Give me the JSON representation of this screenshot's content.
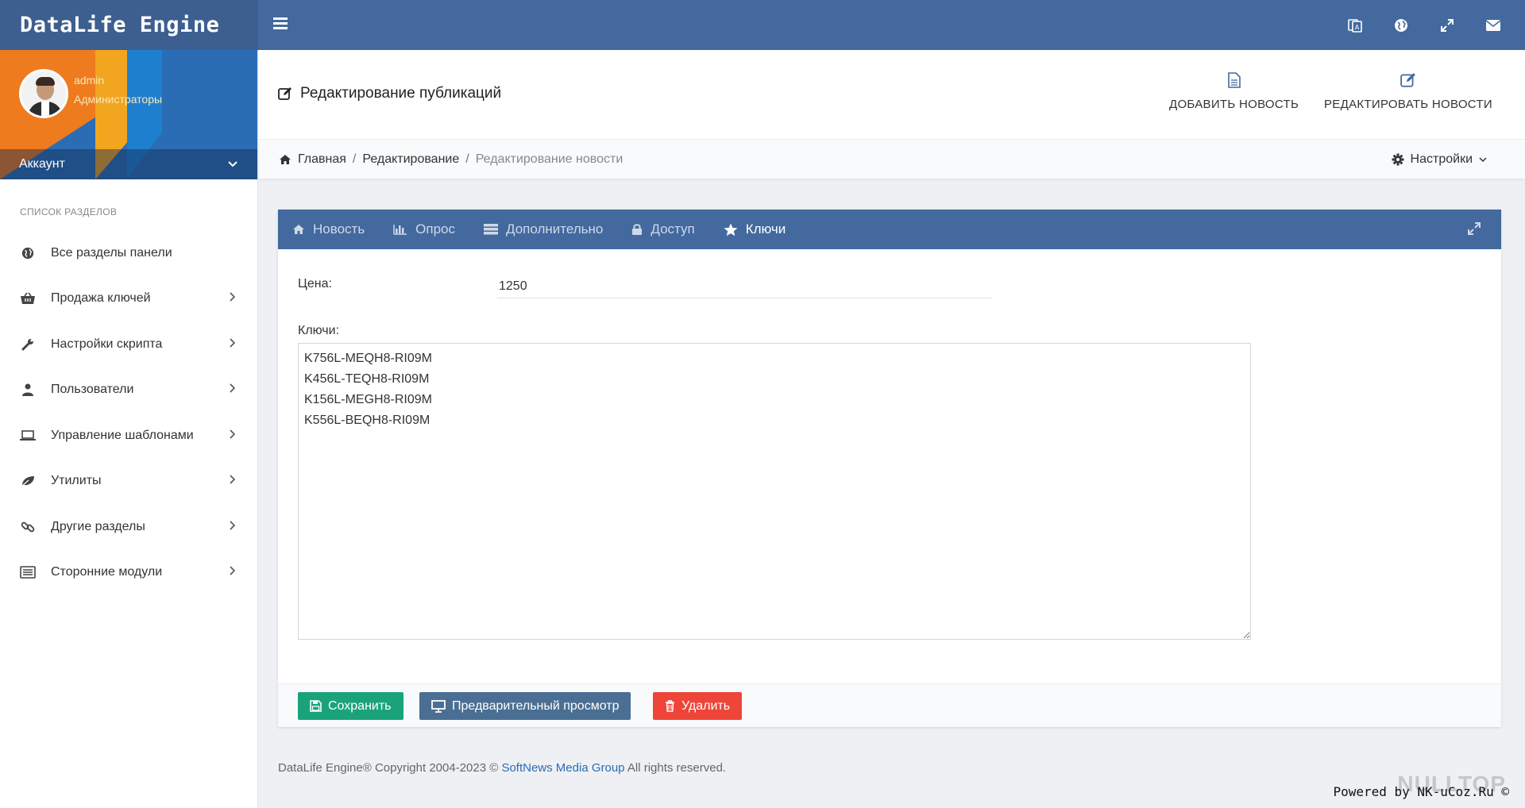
{
  "app": {
    "brand": "DataLife Engine"
  },
  "user": {
    "name": "admin",
    "role": "Администраторы",
    "account_label": "Аккаунт"
  },
  "sidebar": {
    "section_title": "СПИСОК РАЗДЕЛОВ",
    "items": [
      {
        "label": "Все разделы панели",
        "icon": "globe-icon",
        "has_submenu": false
      },
      {
        "label": "Продажа ключей",
        "icon": "basket-icon",
        "has_submenu": true
      },
      {
        "label": "Настройки скрипта",
        "icon": "wrench-icon",
        "has_submenu": true
      },
      {
        "label": "Пользователи",
        "icon": "user-icon",
        "has_submenu": true
      },
      {
        "label": "Управление шаблонами",
        "icon": "laptop-icon",
        "has_submenu": true
      },
      {
        "label": "Утилиты",
        "icon": "leaf-icon",
        "has_submenu": true
      },
      {
        "label": "Другие разделы",
        "icon": "link-icon",
        "has_submenu": true
      },
      {
        "label": "Сторонние модули",
        "icon": "list-icon",
        "has_submenu": true
      }
    ]
  },
  "header": {
    "title": "Редактирование публикаций",
    "actions": [
      {
        "label": "ДОБАВИТЬ НОВОСТЬ",
        "icon": "file-icon"
      },
      {
        "label": "РЕДАКТИРОВАТЬ НОВОСТИ",
        "icon": "edit-icon"
      }
    ]
  },
  "breadcrumb": {
    "home": "Главная",
    "items": [
      "Редактирование"
    ],
    "current": "Редактирование новости",
    "settings_label": "Настройки"
  },
  "tabs": [
    {
      "label": "Новость",
      "icon": "home-icon",
      "active": false
    },
    {
      "label": "Опрос",
      "icon": "bar-chart-icon",
      "active": false
    },
    {
      "label": "Дополнительно",
      "icon": "list-icon",
      "active": false
    },
    {
      "label": "Доступ",
      "icon": "lock-icon",
      "active": false
    },
    {
      "label": "Ключи",
      "icon": "star-icon",
      "active": true
    }
  ],
  "form": {
    "price_label": "Цена:",
    "price_value": "1250",
    "keys_label": "Ключи:",
    "keys_value": "K756L-MEQH8-RI09M\nK456L-TEQH8-RI09M\nK156L-MEGH8-RI09M\nK556L-BEQH8-RI09M"
  },
  "buttons": {
    "save": "Сохранить",
    "preview": "Предварительный просмотр",
    "delete": "Удалить"
  },
  "footer": {
    "prefix": "DataLife Engine® Copyright 2004-2023 ©",
    "link": "SoftNews Media Group",
    "suffix": "All rights reserved.",
    "powered": "Powered by NK-uCoz.Ru ©",
    "watermark": "NULLTOP"
  },
  "colors": {
    "topbar": "#43699e",
    "save": "#1aa37a",
    "preview": "#4a6f93",
    "delete": "#ef4539",
    "link": "#2a6db5"
  }
}
